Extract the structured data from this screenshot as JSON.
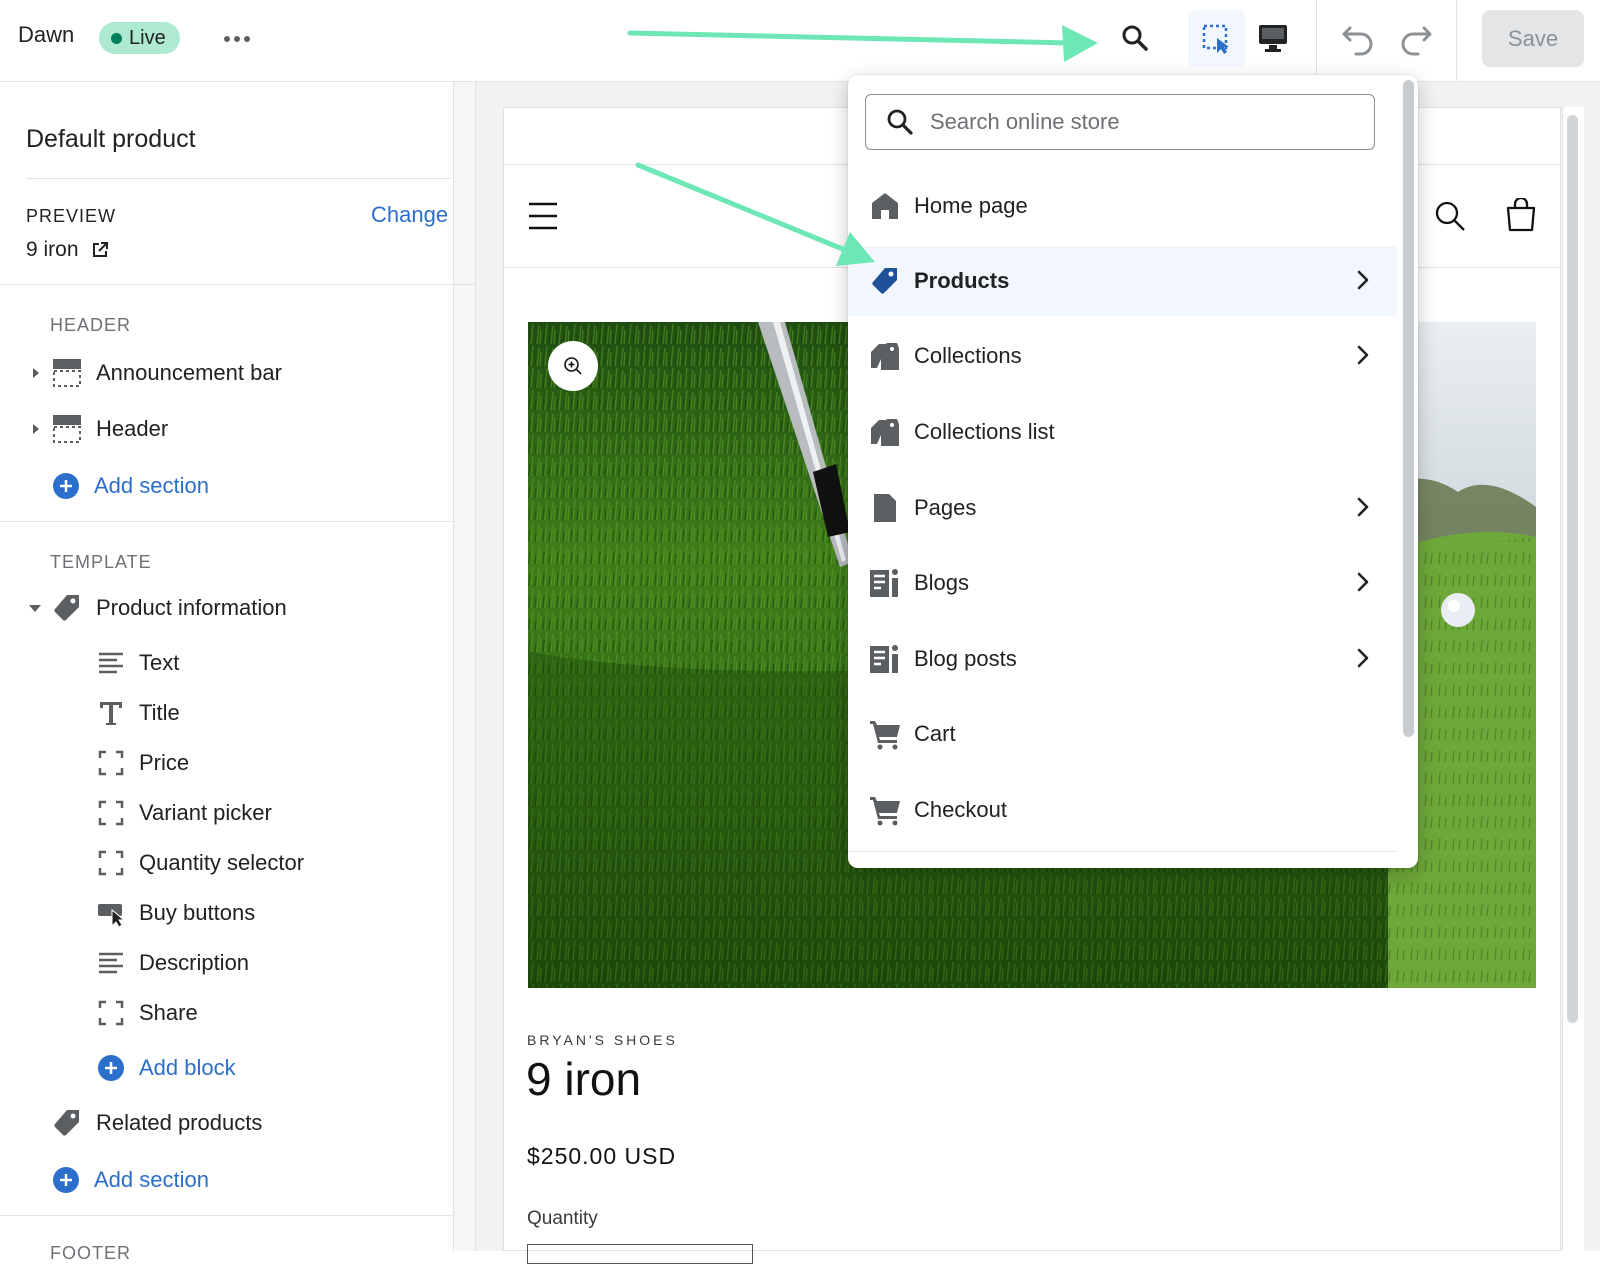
{
  "topbar": {
    "theme_name": "Dawn",
    "live_badge": "Live",
    "save_label": "Save"
  },
  "sidebar": {
    "title": "Default product",
    "preview_label": "PREVIEW",
    "change_link": "Change",
    "preview_value": "9 iron",
    "header_section": {
      "label": "HEADER",
      "items": [
        {
          "label": "Announcement bar",
          "icon": "section-layout-icon"
        },
        {
          "label": "Header",
          "icon": "section-layout-icon"
        }
      ],
      "add_section": "Add section"
    },
    "template_section": {
      "label": "TEMPLATE",
      "group": "Product information",
      "blocks": [
        {
          "label": "Text",
          "icon": "text-lines-icon"
        },
        {
          "label": "Title",
          "icon": "title-t-icon"
        },
        {
          "label": "Price",
          "icon": "block-bracket-icon"
        },
        {
          "label": "Variant picker",
          "icon": "block-bracket-icon"
        },
        {
          "label": "Quantity selector",
          "icon": "block-bracket-icon"
        },
        {
          "label": "Buy buttons",
          "icon": "buy-button-icon"
        },
        {
          "label": "Description",
          "icon": "text-lines-icon"
        },
        {
          "label": "Share",
          "icon": "block-bracket-icon"
        }
      ],
      "add_block": "Add block",
      "related": "Related products",
      "add_section": "Add section"
    },
    "footer_label": "FOOTER"
  },
  "dropdown": {
    "search_placeholder": "Search online store",
    "items": [
      {
        "label": "Home page",
        "icon": "home-icon",
        "has_submenu": false
      },
      {
        "label": "Products",
        "icon": "tag-icon",
        "has_submenu": true,
        "active": true
      },
      {
        "label": "Collections",
        "icon": "collections-icon",
        "has_submenu": true
      },
      {
        "label": "Collections list",
        "icon": "collections-icon",
        "has_submenu": false
      },
      {
        "label": "Pages",
        "icon": "page-icon",
        "has_submenu": true
      },
      {
        "label": "Blogs",
        "icon": "blog-icon",
        "has_submenu": true
      },
      {
        "label": "Blog posts",
        "icon": "blog-icon",
        "has_submenu": true
      },
      {
        "label": "Cart",
        "icon": "cart-icon",
        "has_submenu": false
      },
      {
        "label": "Checkout",
        "icon": "cart-icon",
        "has_submenu": false
      }
    ]
  },
  "store": {
    "vendor": "BRYAN'S SHOES",
    "product_title": "9 iron",
    "price": "$250.00 USD",
    "quantity_label": "Quantity"
  },
  "colors": {
    "accent": "#2c6ecb",
    "live_badge_bg": "#aee9d1",
    "annotation_arrow": "#6ee7b7",
    "active_row": "#f2f7fe"
  }
}
